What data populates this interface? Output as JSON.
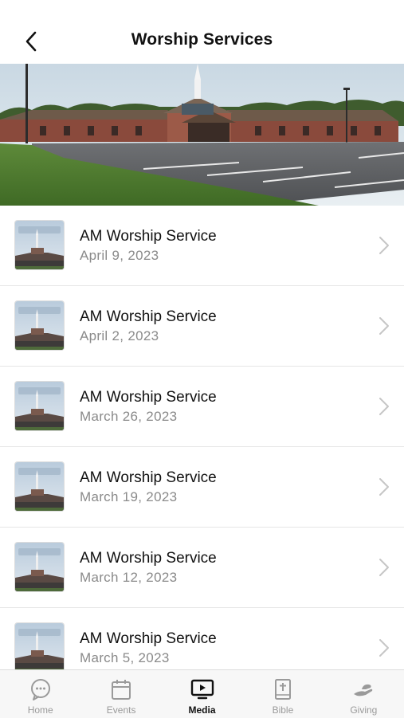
{
  "header": {
    "title": "Worship Services"
  },
  "services": [
    {
      "title": "AM Worship Service",
      "date": "April 9, 2023"
    },
    {
      "title": "AM Worship Service",
      "date": "April 2, 2023"
    },
    {
      "title": "AM Worship Service",
      "date": "March 26, 2023"
    },
    {
      "title": "AM Worship Service",
      "date": "March 19, 2023"
    },
    {
      "title": "AM Worship Service",
      "date": "March 12, 2023"
    },
    {
      "title": "AM Worship Service",
      "date": "March 5, 2023"
    }
  ],
  "tabbar": {
    "home": "Home",
    "events": "Events",
    "media": "Media",
    "bible": "Bible",
    "giving": "Giving",
    "active": "media"
  },
  "colors": {
    "active_tab": "#111111",
    "inactive_tab": "#9a9a9a",
    "date_text": "#8a8a8a"
  }
}
